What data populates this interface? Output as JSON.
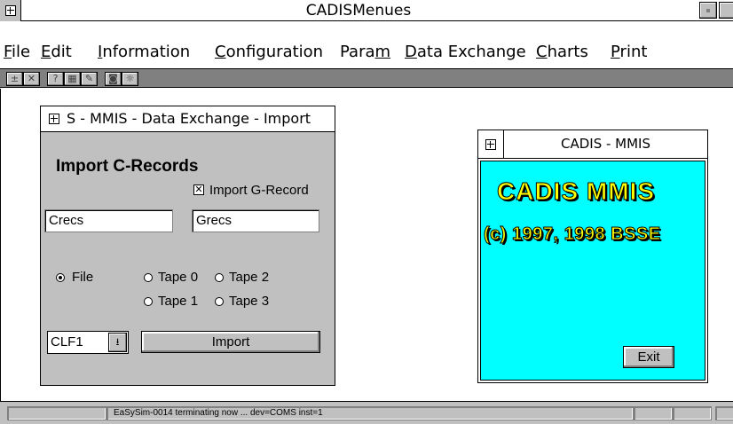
{
  "app": {
    "title": "CADISMenues"
  },
  "menu": [
    {
      "label": "File",
      "mn": "F",
      "rest": "ile"
    },
    {
      "label": "Edit",
      "mn": "E",
      "rest": "dit"
    },
    {
      "label": "Information",
      "mn": "I",
      "rest": "nformation"
    },
    {
      "label": "Configuration",
      "mn": "C",
      "rest": "onfiguration"
    },
    {
      "label": "Param",
      "pre": "Para",
      "mn": "m",
      "rest": ""
    },
    {
      "label": "Data Exchange",
      "mn": "D",
      "rest": "ata Exchange"
    },
    {
      "label": "Charts",
      "mn": "C",
      "rest": "harts"
    },
    {
      "label": "Print",
      "mn": "P",
      "rest": "rint"
    }
  ],
  "toolbar": {
    "buttons": [
      {
        "name": "add-icon",
        "glyph": "±"
      },
      {
        "name": "remove-icon",
        "glyph": "✕"
      },
      {
        "name": "help-icon",
        "glyph": "?"
      },
      {
        "name": "calculator-icon",
        "glyph": "▦"
      },
      {
        "name": "tools-icon",
        "glyph": "✎"
      },
      {
        "name": "camera-icon",
        "glyph": "◙"
      },
      {
        "name": "settings-icon",
        "glyph": "☼"
      }
    ]
  },
  "import_dialog": {
    "title": "S - MMIS - Data Exchange - Import",
    "heading": "Import C-Records",
    "checkbox_label": "Import G-Record",
    "checkbox_checked": true,
    "crecs_value": "Crecs",
    "grecs_value": "Grecs",
    "radio_file": "File",
    "radio_tape0": "Tape 0",
    "radio_tape1": "Tape 1",
    "radio_tape2": "Tape 2",
    "radio_tape3": "Tape 3",
    "selected": "File",
    "device_select": "CLF1",
    "import_button": "Import"
  },
  "splash": {
    "title": "CADIS - MMIS",
    "big_title": "CADIS MMIS",
    "copyright": "(c) 1997, 1998 BSSE",
    "exit_button": "Exit",
    "bg_color": "#00ffff",
    "text_color": "#ffff00"
  },
  "status": {
    "message": "EaSySim-0014 terminating now ... dev=COMS inst=1"
  }
}
